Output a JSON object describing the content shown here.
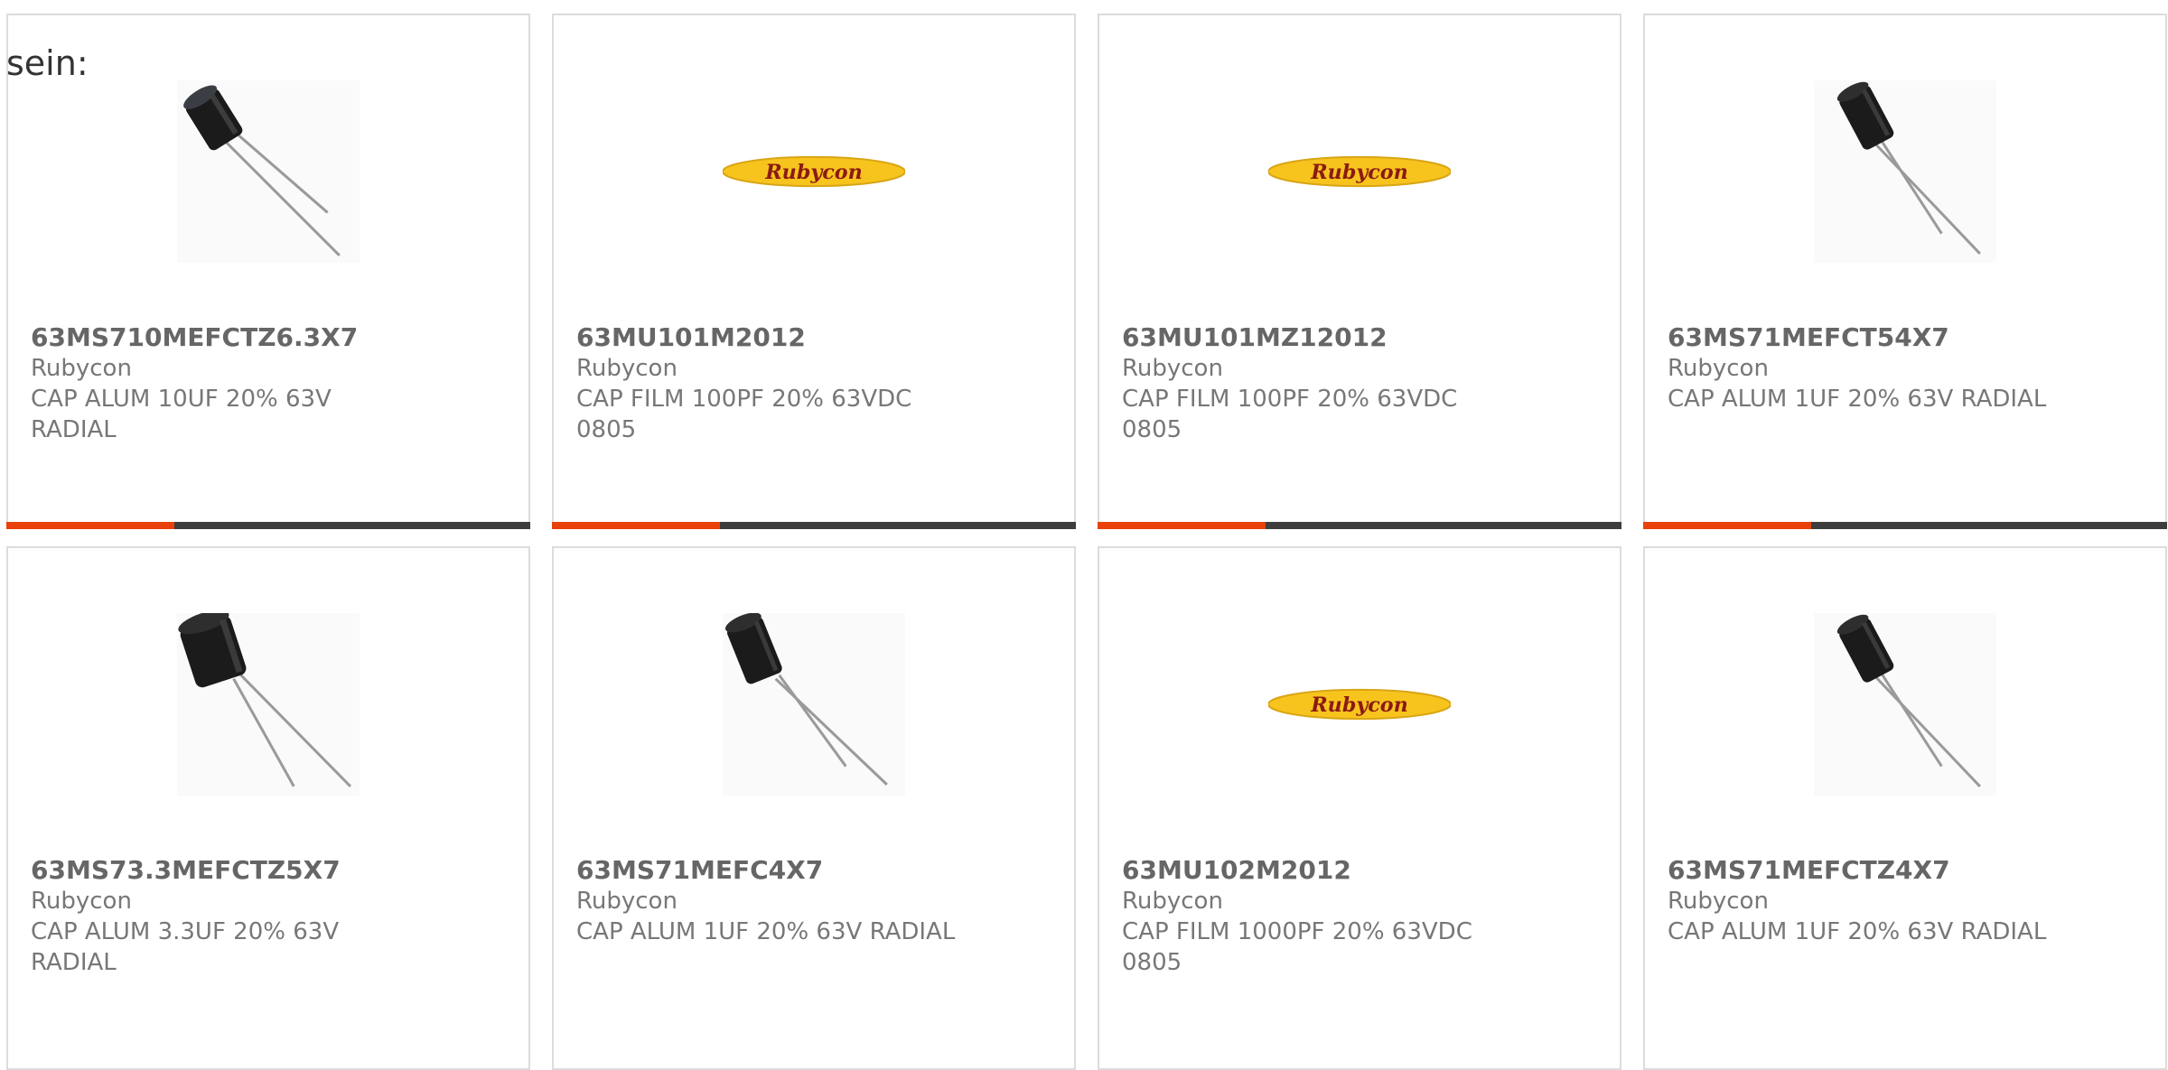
{
  "heading": "sein:",
  "colors": {
    "accent": "#e8410b",
    "bar_track": "#3d3d3d",
    "logo_yellow": "#f7c41e",
    "logo_text": "#8b1a12"
  },
  "cards": [
    {
      "part_number": "63MS710MEFCTZ6.3X7",
      "manufacturer": "Rubycon",
      "description": "CAP ALUM 10UF 20% 63V RADIAL",
      "image": "radial-capacitor-photo",
      "progress": 0.32
    },
    {
      "part_number": "63MU101M2012",
      "manufacturer": "Rubycon",
      "description": "CAP FILM 100PF 20% 63VDC 0805",
      "image": "rubycon-logo",
      "logo_text": "Rubycon",
      "progress": 0.32
    },
    {
      "part_number": "63MU101MZ12012",
      "manufacturer": "Rubycon",
      "description": "CAP FILM 100PF 20% 63VDC 0805",
      "image": "rubycon-logo",
      "logo_text": "Rubycon",
      "progress": 0.32
    },
    {
      "part_number": "63MS71MEFCT54X7",
      "manufacturer": "Rubycon",
      "description": "CAP ALUM 1UF 20% 63V RADIAL",
      "image": "radial-capacitor-photo",
      "progress": 0.32
    },
    {
      "part_number": "63MS73.3MEFCTZ5X7",
      "manufacturer": "Rubycon",
      "description": "CAP ALUM 3.3UF 20% 63V RADIAL",
      "image": "radial-capacitor-photo"
    },
    {
      "part_number": "63MS71MEFC4X7",
      "manufacturer": "Rubycon",
      "description": "CAP ALUM 1UF 20% 63V RADIAL",
      "image": "radial-capacitor-photo"
    },
    {
      "part_number": "63MU102M2012",
      "manufacturer": "Rubycon",
      "description": "CAP FILM 1000PF 20% 63VDC 0805",
      "image": "rubycon-logo",
      "logo_text": "Rubycon"
    },
    {
      "part_number": "63MS71MEFCTZ4X7",
      "manufacturer": "Rubycon",
      "description": "CAP ALUM 1UF 20% 63V RADIAL",
      "image": "radial-capacitor-photo"
    }
  ]
}
